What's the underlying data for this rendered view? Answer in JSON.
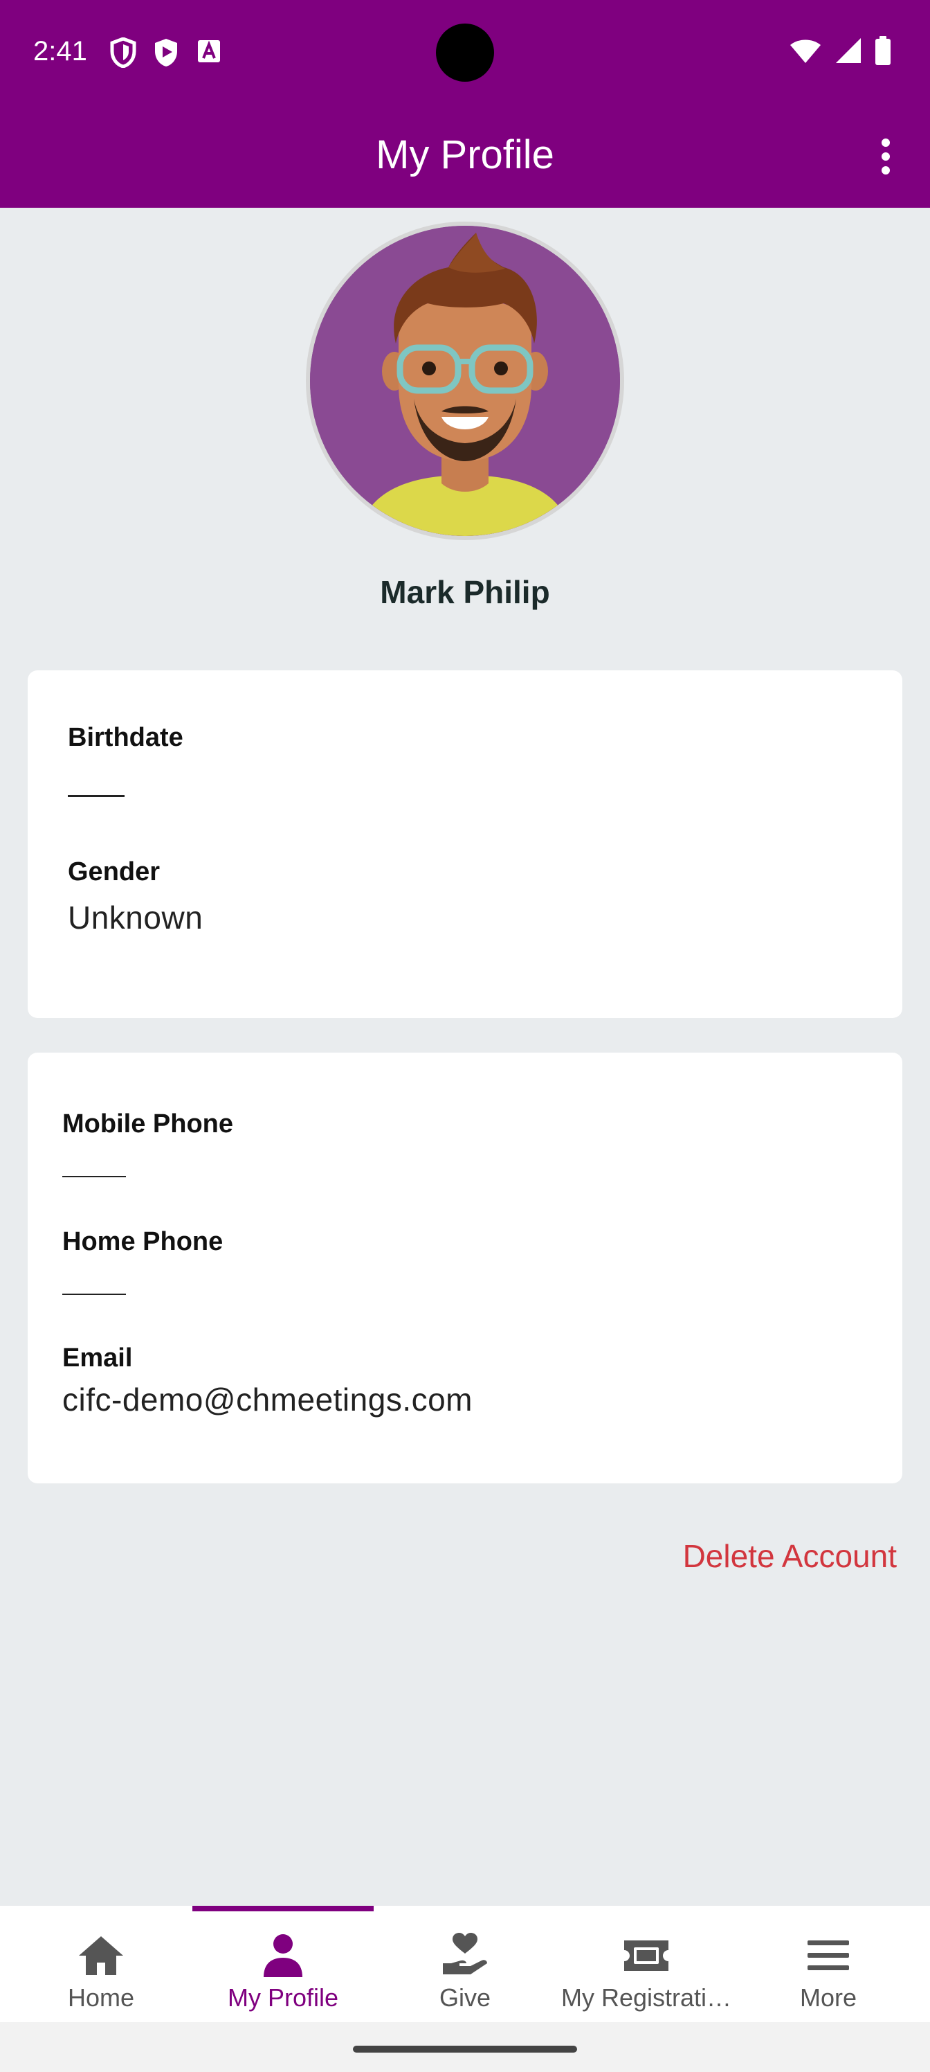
{
  "status_bar": {
    "time": "2:41",
    "left_icons": [
      "shield-icon",
      "play-shield-icon",
      "font-a-icon"
    ],
    "right_icons": [
      "wifi-icon",
      "signal-icon",
      "battery-icon"
    ]
  },
  "app_bar": {
    "title": "My Profile",
    "menu_icon": "more-vert-icon",
    "background": "#7f007f"
  },
  "profile": {
    "name": "Mark Philip"
  },
  "personal": {
    "birthdate_label": "Birthdate",
    "birthdate_value": "",
    "gender_label": "Gender",
    "gender_value": "Unknown"
  },
  "contact": {
    "mobile_label": "Mobile Phone",
    "mobile_value": "",
    "home_label": "Home Phone",
    "home_value": "",
    "email_label": "Email",
    "email_value": "cifc-demo@chmeetings.com"
  },
  "actions": {
    "delete_account": "Delete Account",
    "delete_color": "#d2363e"
  },
  "bottom_nav": {
    "items": [
      {
        "label": "Home",
        "icon": "home-icon",
        "active": false
      },
      {
        "label": "My Profile",
        "icon": "person-icon",
        "active": true
      },
      {
        "label": "Give",
        "icon": "give-hand-heart-icon",
        "active": false
      },
      {
        "label": "My Registrati…",
        "icon": "ticket-icon",
        "active": false
      },
      {
        "label": "More",
        "icon": "menu-icon",
        "active": false
      }
    ],
    "active_color": "#7f007f"
  }
}
